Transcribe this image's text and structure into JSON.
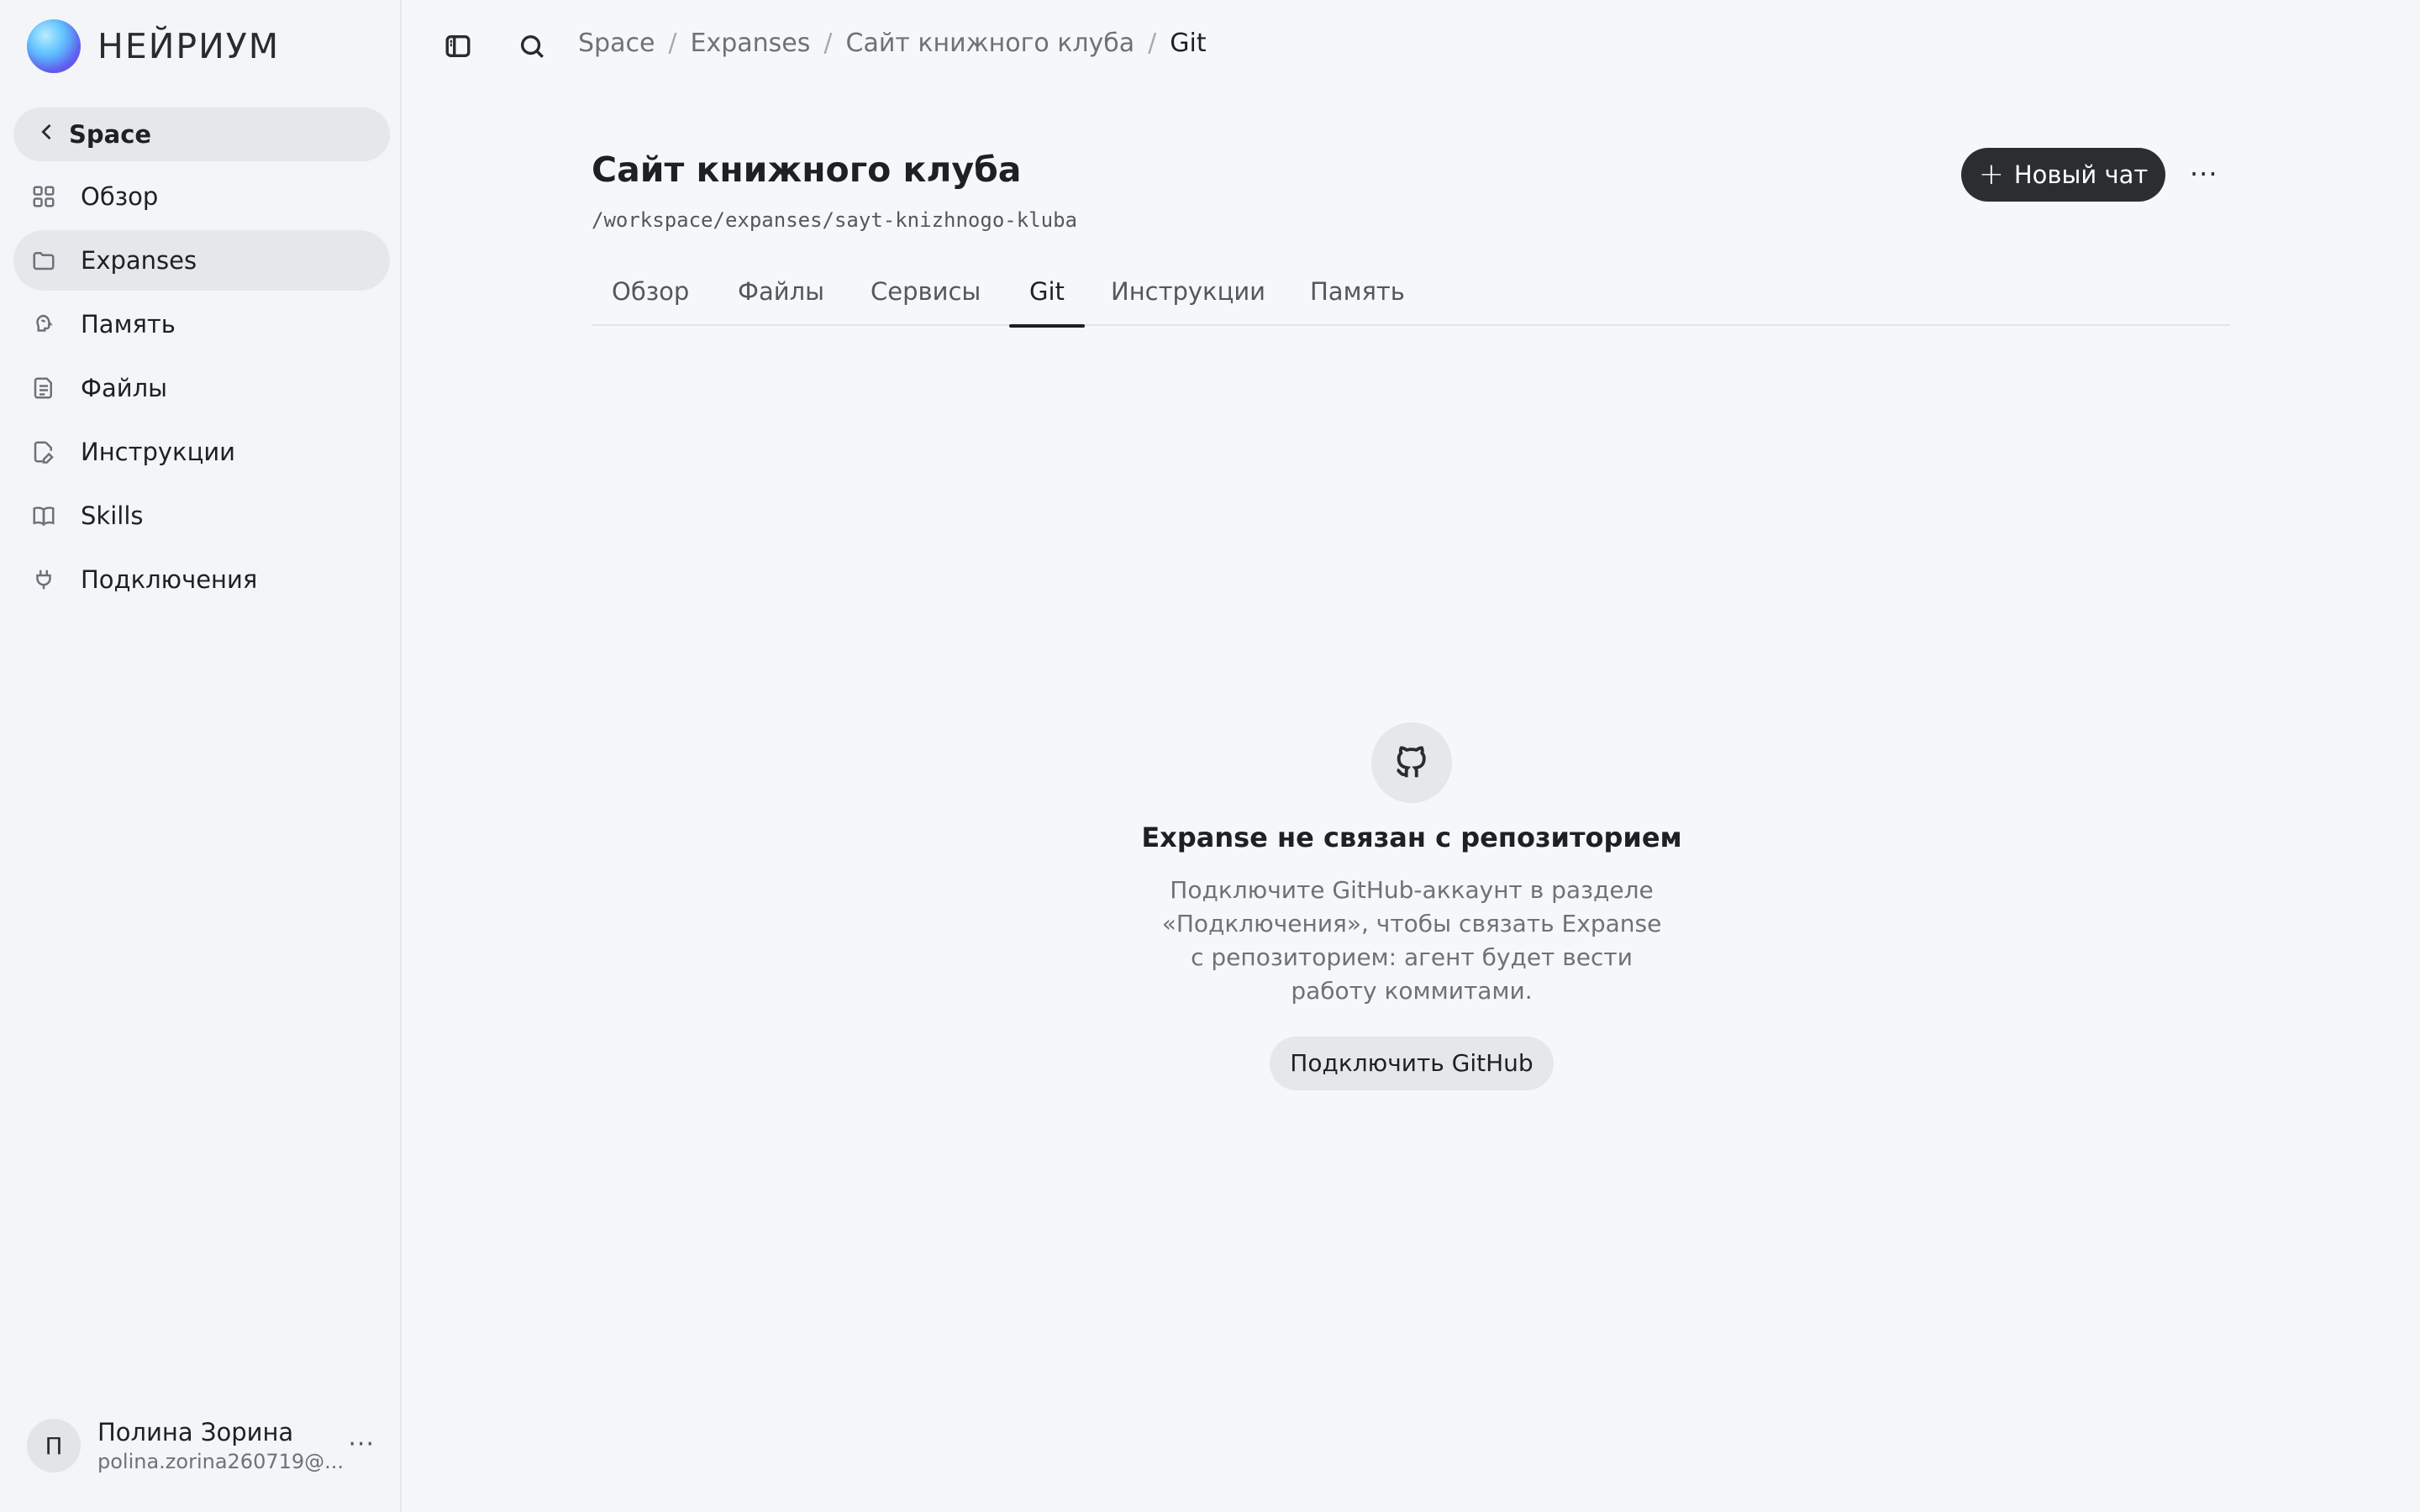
{
  "brand": {
    "name": "НЕЙРИУМ"
  },
  "sidebar": {
    "back_label": "Space",
    "items": [
      {
        "label": "Обзор",
        "icon": "grid-icon",
        "active": false
      },
      {
        "label": "Expanses",
        "icon": "folder-icon",
        "active": true
      },
      {
        "label": "Память",
        "icon": "brain-icon",
        "active": false
      },
      {
        "label": "Файлы",
        "icon": "file-icon",
        "active": false
      },
      {
        "label": "Инструкции",
        "icon": "file-edit-icon",
        "active": false
      },
      {
        "label": "Skills",
        "icon": "book-icon",
        "active": false
      },
      {
        "label": "Подключения",
        "icon": "plug-icon",
        "active": false
      }
    ]
  },
  "user": {
    "initial": "П",
    "name": "Полина Зорина",
    "email": "polina.zorina260719@..."
  },
  "breadcrumbs": [
    "Space",
    "Expanses",
    "Сайт книжного клуба",
    "Git"
  ],
  "header": {
    "title": "Сайт книжного клуба",
    "path": "/workspace/expanses/sayt-knizhnogo-kluba",
    "new_chat_label": "Новый чат"
  },
  "tabs": [
    {
      "label": "Обзор",
      "active": false
    },
    {
      "label": "Файлы",
      "active": false
    },
    {
      "label": "Сервисы",
      "active": false
    },
    {
      "label": "Git",
      "active": true
    },
    {
      "label": "Инструкции",
      "active": false
    },
    {
      "label": "Память",
      "active": false
    }
  ],
  "empty_state": {
    "title": "Expanse не связан с репозиторием",
    "description": "Подключите GitHub-аккаунт в разделе «Подключения», чтобы связать Expanse с репозиторием: агент будет вести работу коммитами.",
    "button_label": "Подключить GitHub"
  }
}
